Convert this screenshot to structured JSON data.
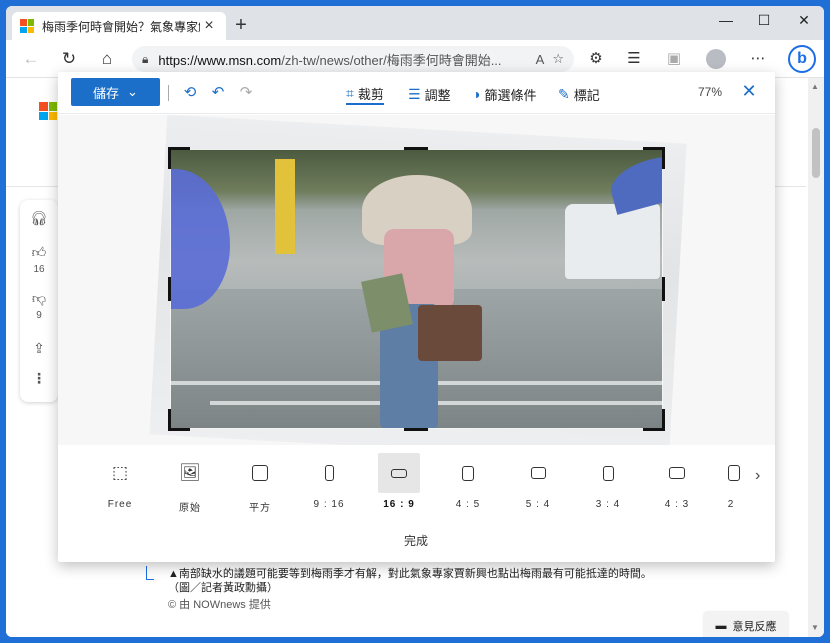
{
  "browser": {
    "tab_title": "梅雨季何時會開始？氣象專家解",
    "tab_close": "×",
    "new_tab": "+",
    "minimize": "—",
    "maximize": "☐",
    "close": "✕",
    "url_host": "https://www.msn.com",
    "url_path": "/zh-tw/news/other/梅雨季何時會開始...",
    "bing_label": "b"
  },
  "brand_colors": {
    "accent": "#1b6fc9",
    "ms_red": "#f25022",
    "ms_green": "#7fba00",
    "ms_blue": "#00a4ef",
    "ms_yellow": "#ffb900"
  },
  "editor": {
    "save_label": "儲存",
    "tabs": [
      {
        "label": "裁剪",
        "icon": "crop-icon",
        "active": true
      },
      {
        "label": "調整",
        "icon": "sliders-icon",
        "active": false
      },
      {
        "label": "篩選條件",
        "icon": "filter-icon",
        "active": false
      },
      {
        "label": "標記",
        "icon": "pen-icon",
        "active": false
      }
    ],
    "zoom": "77%",
    "ratios": [
      {
        "label": "Free",
        "icon": "free-crop-icon",
        "selected": false
      },
      {
        "label": "原始",
        "icon": "original-image-icon",
        "selected": false
      },
      {
        "label": "平方",
        "icon": "square-icon",
        "selected": false
      },
      {
        "label": "9 : 16",
        "icon": "portrait-9-16-icon",
        "selected": false
      },
      {
        "label": "16 : 9",
        "icon": "landscape-16-9-icon",
        "selected": true
      },
      {
        "label": "4 : 5",
        "icon": "portrait-4-5-icon",
        "selected": false
      },
      {
        "label": "5 : 4",
        "icon": "landscape-5-4-icon",
        "selected": false
      },
      {
        "label": "3 : 4",
        "icon": "portrait-3-4-icon",
        "selected": false
      },
      {
        "label": "4 : 3",
        "icon": "landscape-4-3-icon",
        "selected": false
      },
      {
        "label": "2",
        "icon": "portrait-2-icon",
        "selected": false
      }
    ],
    "done_label": "完成"
  },
  "page": {
    "likes": "16",
    "dislikes": "9",
    "caption": "▲南部缺水的議題可能要等到梅雨季才有解，對此氣象專家賈新興也點出梅雨最有可能抵達的時間。（圖／記者黃政勳攝）",
    "credit": "© 由 NOWnews 提供",
    "feedback": "意見反應"
  }
}
